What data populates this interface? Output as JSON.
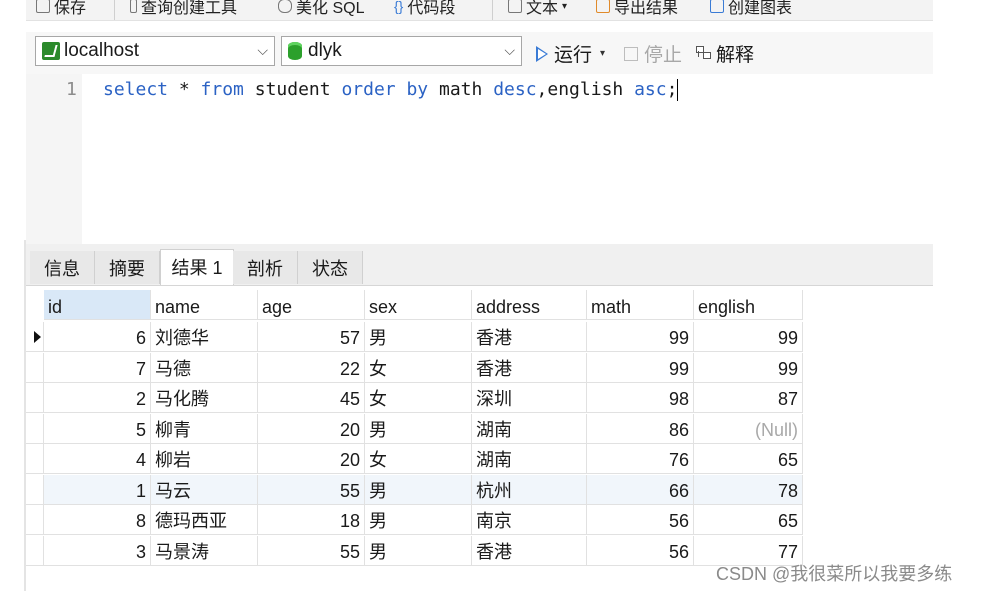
{
  "toolbar": {
    "items": [
      "保存",
      "查询创建工具",
      "美化 SQL",
      "代码段",
      "文本",
      "导出结果",
      "创建图表"
    ]
  },
  "connection": {
    "host": "localhost",
    "database": "dlyk",
    "run_label": "运行",
    "stop_label": "停止",
    "explain_label": "解释"
  },
  "editor": {
    "line_number": "1",
    "code": {
      "t1": "select",
      "t2": " * ",
      "t3": "from",
      "t4": " student ",
      "t5": "order by",
      "t6": " math ",
      "t7": "desc",
      "t8": ",english ",
      "t9": "asc",
      "t10": ";"
    }
  },
  "tabs": [
    "信息",
    "摘要",
    "结果 1",
    "剖析",
    "状态"
  ],
  "active_tab": "结果 1",
  "table": {
    "columns": [
      "id",
      "name",
      "age",
      "sex",
      "address",
      "math",
      "english"
    ],
    "rows": [
      [
        "6",
        "刘德华",
        "57",
        "男",
        "香港",
        "99",
        "99"
      ],
      [
        "7",
        "马德",
        "22",
        "女",
        "香港",
        "99",
        "99"
      ],
      [
        "2",
        "马化腾",
        "45",
        "女",
        "深圳",
        "98",
        "87"
      ],
      [
        "5",
        "柳青",
        "20",
        "男",
        "湖南",
        "86",
        "(Null)"
      ],
      [
        "4",
        "柳岩",
        "20",
        "女",
        "湖南",
        "76",
        "65"
      ],
      [
        "1",
        "马云",
        "55",
        "男",
        "杭州",
        "66",
        "78"
      ],
      [
        "8",
        "德玛西亚",
        "18",
        "男",
        "南京",
        "56",
        "65"
      ],
      [
        "3",
        "马景涛",
        "55",
        "男",
        "香港",
        "56",
        "77"
      ]
    ]
  },
  "watermark": "CSDN @我很菜所以我要多练"
}
